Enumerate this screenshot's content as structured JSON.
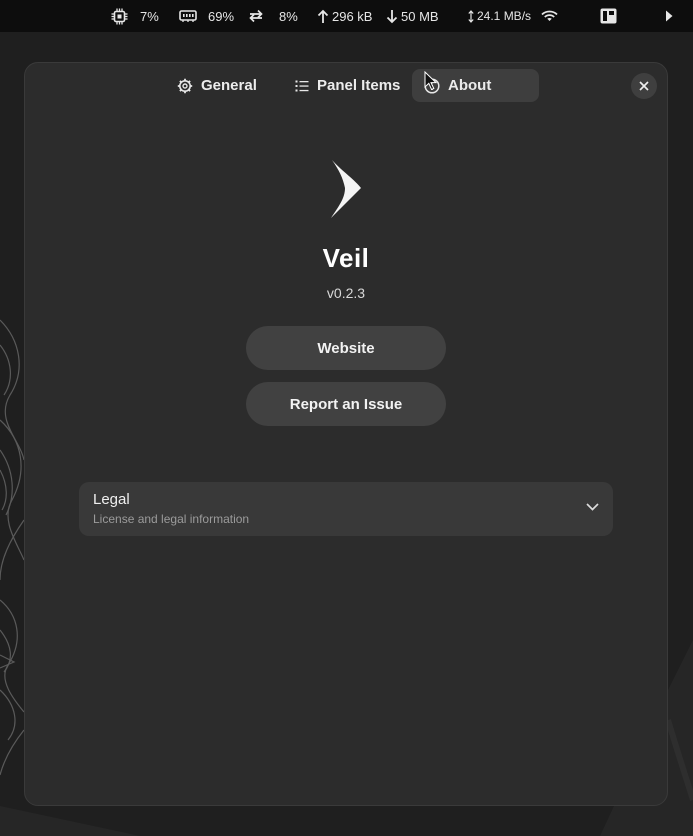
{
  "topbar": {
    "cpu": "7%",
    "memory": "69%",
    "swap": "8%",
    "upload": "296 kB",
    "download": "50 MB",
    "disk_speed": "24.1 MB/s"
  },
  "window": {
    "tabs": [
      {
        "label": "General",
        "icon": "gear-icon",
        "active": false
      },
      {
        "label": "Panel Items",
        "icon": "list-icon",
        "active": false
      },
      {
        "label": "About",
        "icon": "info-icon",
        "active": true
      }
    ],
    "close_icon": "close-icon"
  },
  "about": {
    "app_name": "Veil",
    "version": "v0.2.3",
    "website_button": "Website",
    "report_button": "Report an Issue",
    "legal": {
      "title": "Legal",
      "subtitle": "License and legal information"
    }
  },
  "colors": {
    "topbar_bg": "#0d0d0d",
    "window_bg": "#2c2c2c",
    "button_bg": "#414141",
    "row_bg": "#393939",
    "active_tab_bg": "#3e3e3e"
  }
}
